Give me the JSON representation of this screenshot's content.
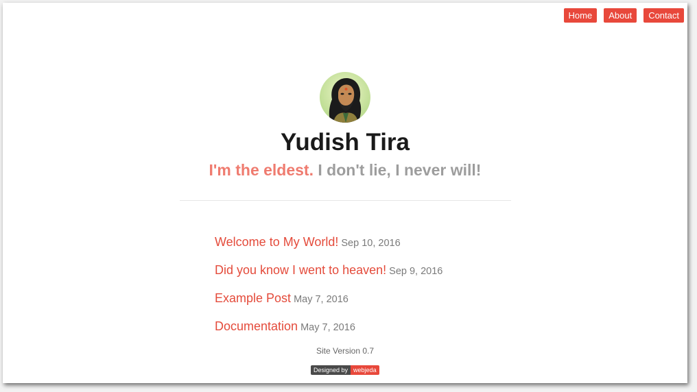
{
  "nav": {
    "items": [
      {
        "label": "Home"
      },
      {
        "label": "About"
      },
      {
        "label": "Contact"
      }
    ]
  },
  "profile": {
    "name": "Yudish Tira",
    "tagline_highlight": "I'm the eldest.",
    "tagline_rest": "I don't lie, I never will!"
  },
  "posts": [
    {
      "title": "Welcome to My World!",
      "date": "Sep 10, 2016"
    },
    {
      "title": "Did you know I went to heaven!",
      "date": "Sep 9, 2016"
    },
    {
      "title": "Example Post",
      "date": "May 7, 2016"
    },
    {
      "title": "Documentation",
      "date": "May 7, 2016"
    }
  ],
  "footer": {
    "version": "Site Version 0.7",
    "badge_left": "Designed by",
    "badge_right": "webjeda"
  },
  "colors": {
    "accent": "#e8483b",
    "tagline_highlight": "#ef7b6f",
    "muted": "#9d9d9d"
  }
}
